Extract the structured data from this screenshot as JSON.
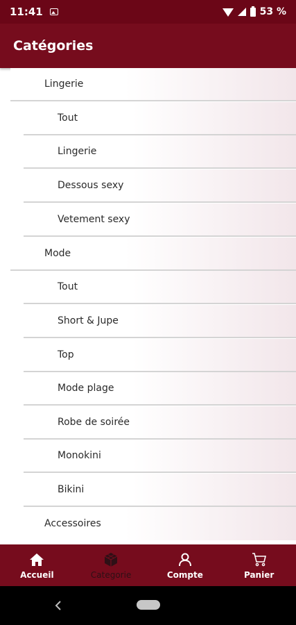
{
  "status_bar": {
    "time": "11:41",
    "battery": "53 %"
  },
  "app_bar": {
    "title": "Catégories"
  },
  "categories": [
    {
      "label": "Lingerie",
      "children": [
        "Tout",
        "Lingerie",
        "Dessous sexy",
        "Vetement sexy"
      ]
    },
    {
      "label": "Mode",
      "children": [
        "Tout",
        "Short & Jupe",
        "Top",
        "Mode plage",
        "Robe de soirée",
        "Monokini",
        "Bikini"
      ]
    },
    {
      "label": "Accessoires",
      "children": []
    }
  ],
  "bottom_nav": {
    "active": "categorie",
    "items": [
      {
        "key": "accueil",
        "label": "Accueil",
        "icon": "home-icon"
      },
      {
        "key": "categorie",
        "label": "Categorie",
        "icon": "cube-icon"
      },
      {
        "key": "compte",
        "label": "Compte",
        "icon": "user-icon"
      },
      {
        "key": "panier",
        "label": "Panier",
        "icon": "cart-icon"
      }
    ]
  },
  "colors": {
    "primary": "#760c1d",
    "status_bar": "#6b0617",
    "active_nav": "#2e1016",
    "divider": "#d4d4d4"
  }
}
